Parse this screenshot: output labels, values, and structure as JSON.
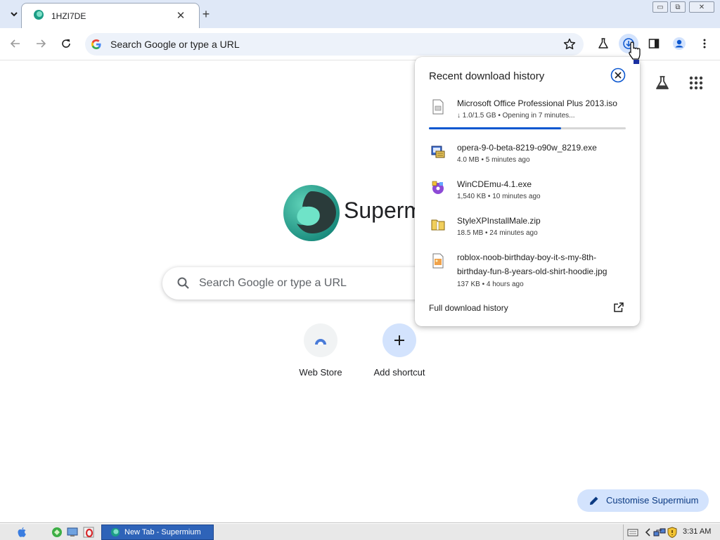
{
  "tab": {
    "title": "1HZI7DE",
    "close_label": "✕"
  },
  "new_tab_label": "+",
  "window_controls": {
    "minimize": "▭",
    "restore": "⧉",
    "close": "✕"
  },
  "toolbar": {
    "omnibox_text": "Search Google or type a URL"
  },
  "ntp": {
    "logo_text": "Supermium",
    "search_placeholder": "Search Google or type a URL",
    "shortcuts": [
      {
        "label": "Web Store",
        "icon": "web-store-icon"
      },
      {
        "label": "Add shortcut",
        "icon": "plus-icon"
      }
    ],
    "customise_label": "Customise Supermium"
  },
  "downloads": {
    "title": "Recent download history",
    "items": [
      {
        "name": "Microsoft Office Professional Plus 2013.iso",
        "meta": "↓ 1.0/1.5 GB • Opening in 7 minutes...",
        "progress": 0.67,
        "icon": "iso-file-icon"
      },
      {
        "name": "opera-9-0-beta-8219-o90w_8219.exe",
        "meta": "4.0 MB • 5 minutes ago",
        "icon": "installer-icon"
      },
      {
        "name": "WinCDEmu-4.1.exe",
        "meta": "1,540 KB • 10 minutes ago",
        "icon": "wincdemu-icon"
      },
      {
        "name": "StyleXPInstallMale.zip",
        "meta": "18.5 MB • 24 minutes ago",
        "icon": "zip-folder-icon"
      },
      {
        "name_line1": "roblox-noob-birthday-boy-it-s-my-8th-",
        "name_line2": "birthday-fun-8-years-old-shirt-hoodie.jpg",
        "meta": "137 KB • 4 hours ago",
        "icon": "image-file-icon"
      }
    ],
    "full_history_label": "Full download history"
  },
  "taskbar": {
    "task_label": "New Tab - Supermium",
    "clock": "3:31 AM"
  },
  "colors": {
    "accent": "#0b57d0",
    "tabstrip": "#dfe8f7",
    "omnibox": "#edf2fa",
    "taskbar_button": "#2e63b8"
  }
}
